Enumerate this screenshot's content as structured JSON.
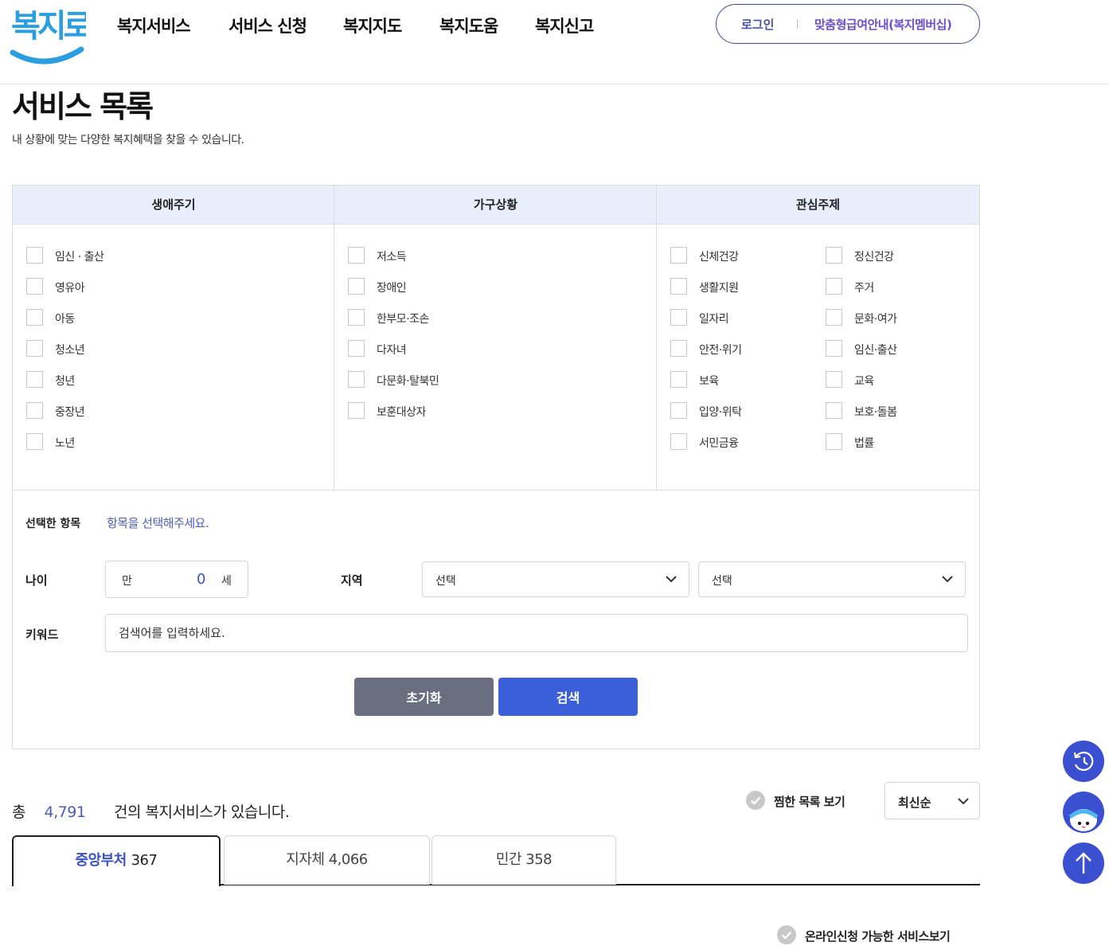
{
  "header": {
    "logo_text": "복지로",
    "nav": [
      "복지서비스",
      "서비스 신청",
      "복지지도",
      "복지도움",
      "복지신고"
    ],
    "login": "로그인",
    "membership": "맞춤형급여안내(복지멤버십)"
  },
  "page": {
    "title": "서비스 목록",
    "desc": "내 상황에 맞는 다양한 복지혜택을 찾을 수 있습니다."
  },
  "filter": {
    "columns": [
      "생애주기",
      "가구상황",
      "관심주제"
    ],
    "life_cycle": [
      "임신 · 출산",
      "영유아",
      "아동",
      "청소년",
      "청년",
      "중장년",
      "노년"
    ],
    "household": [
      "저소득",
      "장애인",
      "한부모·조손",
      "다자녀",
      "다문화·탈북민",
      "보훈대상자"
    ],
    "interest_left": [
      "신체건강",
      "생활지원",
      "일자리",
      "안전·위기",
      "보육",
      "입양·위탁",
      "서민금융"
    ],
    "interest_right": [
      "정신건강",
      "주거",
      "문화·여가",
      "임신·출산",
      "교육",
      "보호·돌봄",
      "법률"
    ],
    "selected_label": "선택한 항목",
    "selected_hint": "항목을 선택해주세요.",
    "age_label": "나이",
    "age_prefix": "만",
    "age_value": "0",
    "age_suffix": "세",
    "region_label": "지역",
    "region1": "선택",
    "region2": "선택",
    "keyword_label": "키워드",
    "keyword_placeholder": "검색어를 입력하세요.",
    "reset_label": "초기화",
    "search_label": "검색"
  },
  "results": {
    "total_prefix": "총",
    "total_count": "4,791",
    "total_suffix": "건의 복지서비스가 있습니다.",
    "favorites_label": "찜한 목록 보기",
    "sort_value": "최신순",
    "tabs": [
      {
        "label": "중앙부처",
        "count": "367"
      },
      {
        "label": "지자체",
        "count": "4,066"
      },
      {
        "label": "민간",
        "count": "358"
      }
    ],
    "online_label": "온라인신청 가능한 서비스보기"
  },
  "floating": [
    "history-icon",
    "chatbot-icon",
    "arrow-up-icon"
  ],
  "colors": {
    "accent": "#3b5fd9",
    "header_bg": "#e9eefb",
    "reset_btn": "#6b6e80",
    "count_blue": "#4a5bb8",
    "float_btn": "#3b4fd1"
  }
}
